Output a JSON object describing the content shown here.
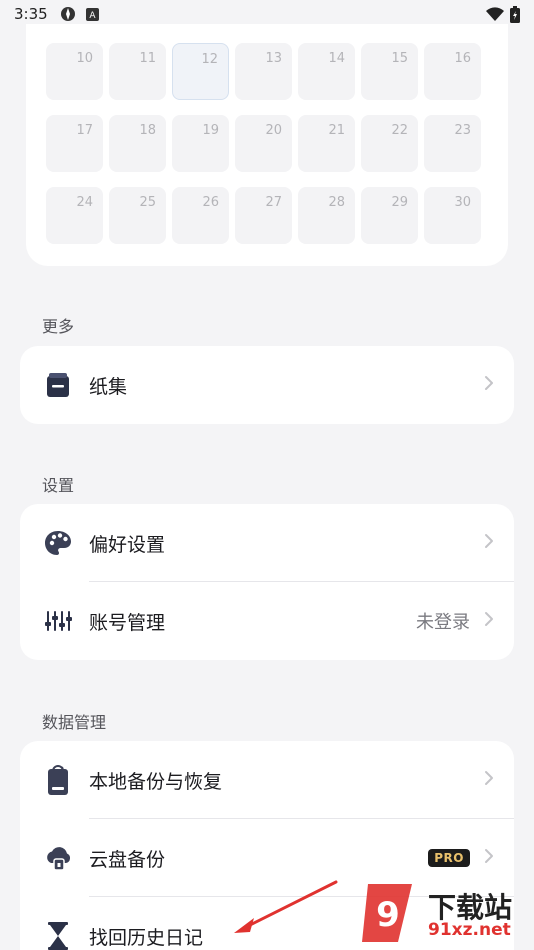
{
  "status_bar": {
    "time": "3:35"
  },
  "calendar": {
    "today": "12",
    "rows": [
      [
        "10",
        "11",
        "12",
        "13",
        "14",
        "15",
        "16"
      ],
      [
        "17",
        "18",
        "19",
        "20",
        "21",
        "22",
        "23"
      ],
      [
        "24",
        "25",
        "26",
        "27",
        "28",
        "29",
        "30"
      ]
    ]
  },
  "sections": {
    "more": {
      "title": "更多",
      "items": [
        {
          "label": "纸集",
          "icon": "notebook-icon"
        }
      ]
    },
    "settings": {
      "title": "设置",
      "items": [
        {
          "label": "偏好设置",
          "icon": "palette-icon"
        },
        {
          "label": "账号管理",
          "icon": "sliders-icon",
          "value": "未登录"
        }
      ]
    },
    "data": {
      "title": "数据管理",
      "items": [
        {
          "label": "本地备份与恢复",
          "icon": "local-backup-icon"
        },
        {
          "label": "云盘备份",
          "icon": "cloud-backup-icon",
          "badge": "PRO"
        },
        {
          "label": "找回历史日记",
          "icon": "hourglass-icon"
        }
      ]
    }
  },
  "watermark": {
    "brand": "下载站",
    "url": "91xz.net"
  },
  "colors": {
    "background": "#f4f4f6",
    "card": "#ffffff",
    "pro_badge_bg": "#1c1c1c",
    "pro_badge_text": "#e9c16c",
    "arrow": "#e0322f"
  }
}
